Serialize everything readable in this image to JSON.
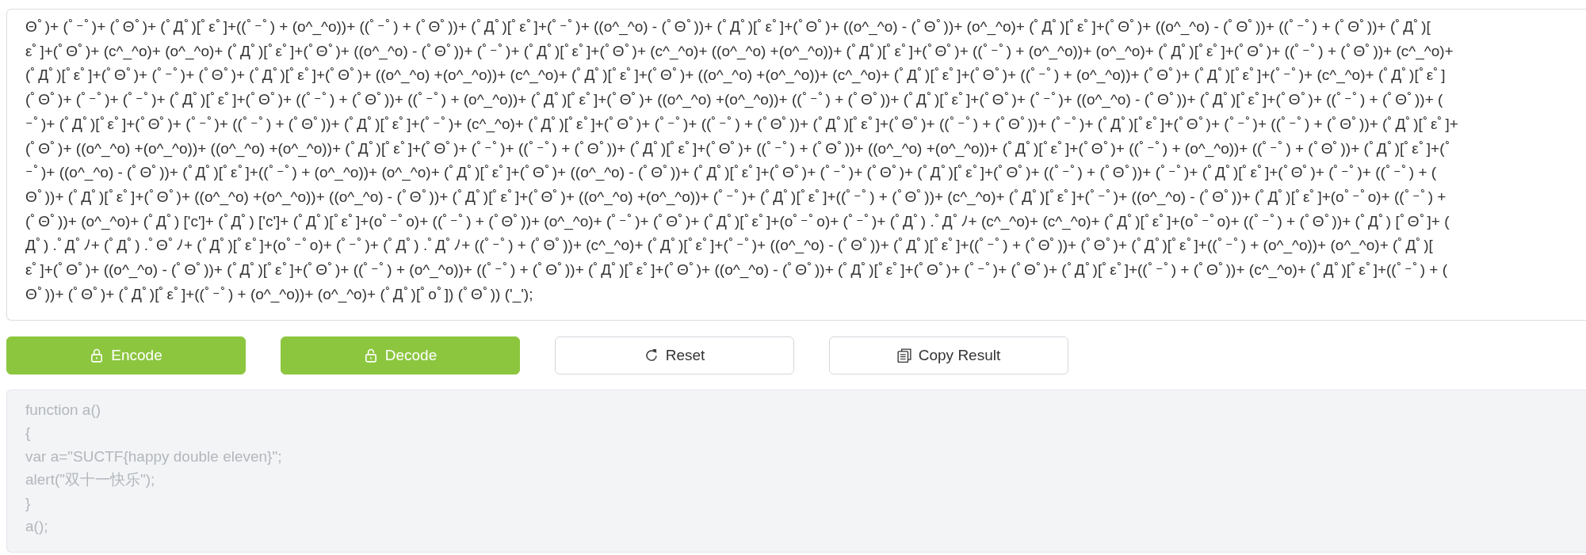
{
  "input": {
    "lines": [
      "Θﾟ)+ (ﾟｰﾟ)+ (ﾟΘﾟ)+ (ﾟДﾟ)[ﾟεﾟ]+((ﾟｰﾟ) + (o^_^o))+ ((ﾟｰﾟ) + (ﾟΘﾟ))+ (ﾟДﾟ)[ﾟεﾟ]+(ﾟｰﾟ)+ ((o^_^o) - (ﾟΘﾟ))+ (ﾟДﾟ)[ﾟεﾟ]+(ﾟΘﾟ)+ ((o^_^o) - (ﾟΘﾟ))+ (o^_^o)+ (ﾟДﾟ)[ﾟεﾟ]+(ﾟΘﾟ)+ ((o^_^o) - (ﾟΘﾟ))+ ((ﾟｰﾟ) + (ﾟΘﾟ))+ (ﾟДﾟ)[",
      "εﾟ]+(ﾟΘﾟ)+ (c^_^o)+ (o^_^o)+ (ﾟДﾟ)[ﾟεﾟ]+(ﾟΘﾟ)+ ((o^_^o) - (ﾟΘﾟ))+ (ﾟｰﾟ)+ (ﾟДﾟ)[ﾟεﾟ]+(ﾟΘﾟ)+ (c^_^o)+ ((o^_^o) +(o^_^o))+ (ﾟДﾟ)[ﾟεﾟ]+(ﾟΘﾟ)+ ((ﾟｰﾟ) + (o^_^o))+ (o^_^o)+ (ﾟДﾟ)[ﾟεﾟ]+(ﾟΘﾟ)+ ((ﾟｰﾟ) + (ﾟΘﾟ))+ (c^_^o)+",
      "(ﾟДﾟ)[ﾟεﾟ]+(ﾟΘﾟ)+ (ﾟｰﾟ)+ (ﾟΘﾟ)+ (ﾟДﾟ)[ﾟεﾟ]+(ﾟΘﾟ)+ ((o^_^o) +(o^_^o))+ (c^_^o)+ (ﾟДﾟ)[ﾟεﾟ]+(ﾟΘﾟ)+ ((o^_^o) +(o^_^o))+ (c^_^o)+ (ﾟДﾟ)[ﾟεﾟ]+(ﾟΘﾟ)+ ((ﾟｰﾟ) + (o^_^o))+ (ﾟΘﾟ)+ (ﾟДﾟ)[ﾟεﾟ]+(ﾟｰﾟ)+ (c^_^o)+ (ﾟДﾟ)[ﾟεﾟ]",
      "(ﾟΘﾟ)+ (ﾟｰﾟ)+ (ﾟｰﾟ)+ (ﾟДﾟ)[ﾟεﾟ]+(ﾟΘﾟ)+ ((ﾟｰﾟ) + (ﾟΘﾟ))+ ((ﾟｰﾟ) + (o^_^o))+ (ﾟДﾟ)[ﾟεﾟ]+(ﾟΘﾟ)+ ((o^_^o) +(o^_^o))+ ((ﾟｰﾟ) + (ﾟΘﾟ))+ (ﾟДﾟ)[ﾟεﾟ]+(ﾟΘﾟ)+ (ﾟｰﾟ)+ ((o^_^o) - (ﾟΘﾟ))+ (ﾟДﾟ)[ﾟεﾟ]+(ﾟΘﾟ)+ ((ﾟｰﾟ) + (ﾟΘﾟ))+ (",
      "ｰﾟ)+ (ﾟДﾟ)[ﾟεﾟ]+(ﾟΘﾟ)+ (ﾟｰﾟ)+ ((ﾟｰﾟ) + (ﾟΘﾟ))+ (ﾟДﾟ)[ﾟεﾟ]+(ﾟｰﾟ)+ (c^_^o)+ (ﾟДﾟ)[ﾟεﾟ]+(ﾟΘﾟ)+ (ﾟｰﾟ)+ ((ﾟｰﾟ) + (ﾟΘﾟ))+ (ﾟДﾟ)[ﾟεﾟ]+(ﾟΘﾟ)+ ((ﾟｰﾟ) + (ﾟΘﾟ))+ (ﾟｰﾟ)+ (ﾟДﾟ)[ﾟεﾟ]+(ﾟΘﾟ)+ (ﾟｰﾟ)+ ((ﾟｰﾟ) + (ﾟΘﾟ))+ (ﾟДﾟ)[ﾟεﾟ]+",
      "(ﾟΘﾟ)+ ((o^_^o) +(o^_^o))+ ((o^_^o) +(o^_^o))+ (ﾟДﾟ)[ﾟεﾟ]+(ﾟΘﾟ)+ (ﾟｰﾟ)+ ((ﾟｰﾟ) + (ﾟΘﾟ))+ (ﾟДﾟ)[ﾟεﾟ]+(ﾟΘﾟ)+ ((ﾟｰﾟ) + (ﾟΘﾟ))+ ((o^_^o) +(o^_^o))+ (ﾟДﾟ)[ﾟεﾟ]+(ﾟΘﾟ)+ ((ﾟｰﾟ) + (o^_^o))+ ((ﾟｰﾟ) + (ﾟΘﾟ))+ (ﾟДﾟ)[ﾟεﾟ]+(ﾟ",
      "ｰﾟ)+ ((o^_^o) - (ﾟΘﾟ))+ (ﾟДﾟ)[ﾟεﾟ]+((ﾟｰﾟ) + (o^_^o))+ (o^_^o)+ (ﾟДﾟ)[ﾟεﾟ]+(ﾟΘﾟ)+ ((o^_^o) - (ﾟΘﾟ))+ (ﾟДﾟ)[ﾟεﾟ]+(ﾟΘﾟ)+ (ﾟｰﾟ)+ (ﾟΘﾟ)+ (ﾟДﾟ)[ﾟεﾟ]+(ﾟΘﾟ)+ ((ﾟｰﾟ) + (ﾟΘﾟ))+ (ﾟｰﾟ)+ (ﾟДﾟ)[ﾟεﾟ]+(ﾟΘﾟ)+ (ﾟｰﾟ)+ ((ﾟｰﾟ) + (",
      "Θﾟ))+ (ﾟДﾟ)[ﾟεﾟ]+(ﾟΘﾟ)+ ((o^_^o) +(o^_^o))+ ((o^_^o) - (ﾟΘﾟ))+ (ﾟДﾟ)[ﾟεﾟ]+(ﾟΘﾟ)+ ((o^_^o) +(o^_^o))+ (ﾟｰﾟ)+ (ﾟДﾟ)[ﾟεﾟ]+((ﾟｰﾟ) + (ﾟΘﾟ))+ (c^_^o)+ (ﾟДﾟ)[ﾟεﾟ]+(ﾟｰﾟ)+ ((o^_^o) - (ﾟΘﾟ))+ (ﾟДﾟ)[ﾟεﾟ]+(oﾟｰﾟo)+ ((ﾟｰﾟ) +",
      "(ﾟΘﾟ))+ (o^_^o)+ (ﾟДﾟ) ['c']+ (ﾟДﾟ) ['c']+ (ﾟДﾟ)[ﾟεﾟ]+(oﾟｰﾟo)+ ((ﾟｰﾟ) + (ﾟΘﾟ))+ (o^_^o)+ (ﾟｰﾟ)+ (ﾟΘﾟ)+ (ﾟДﾟ)[ﾟεﾟ]+(oﾟｰﾟo)+ (ﾟｰﾟ)+ (ﾟДﾟ) .ﾟДﾟﾉ+ (c^_^o)+ (c^_^o)+ (ﾟДﾟ)[ﾟεﾟ]+(oﾟｰﾟo)+ ((ﾟｰﾟ) + (ﾟΘﾟ))+ (ﾟДﾟ) [ﾟΘﾟ]+ (",
      "Дﾟ) .ﾟДﾟﾉ+ (ﾟДﾟ) .ﾟΘﾟﾉ+ (ﾟДﾟ)[ﾟεﾟ]+(oﾟｰﾟo)+ (ﾟｰﾟ)+ (ﾟДﾟ) .ﾟДﾟﾉ+ ((ﾟｰﾟ) + (ﾟΘﾟ))+ (c^_^o)+ (ﾟДﾟ)[ﾟεﾟ]+(ﾟｰﾟ)+ ((o^_^o) - (ﾟΘﾟ))+ (ﾟДﾟ)[ﾟεﾟ]+((ﾟｰﾟ) + (ﾟΘﾟ))+ (ﾟΘﾟ)+ (ﾟДﾟ)[ﾟεﾟ]+((ﾟｰﾟ) + (o^_^o))+ (o^_^o)+ (ﾟДﾟ)[",
      "εﾟ]+(ﾟΘﾟ)+ ((o^_^o) - (ﾟΘﾟ))+ (ﾟДﾟ)[ﾟεﾟ]+(ﾟΘﾟ)+ ((ﾟｰﾟ) + (o^_^o))+ ((ﾟｰﾟ) + (ﾟΘﾟ))+ (ﾟДﾟ)[ﾟεﾟ]+(ﾟΘﾟ)+ ((o^_^o) - (ﾟΘﾟ))+ (ﾟДﾟ)[ﾟεﾟ]+(ﾟΘﾟ)+ (ﾟｰﾟ)+ (ﾟΘﾟ)+ (ﾟДﾟ)[ﾟεﾟ]+((ﾟｰﾟ) + (ﾟΘﾟ))+ (c^_^o)+ (ﾟДﾟ)[ﾟεﾟ]+((ﾟｰﾟ) + (",
      "Θﾟ))+ (ﾟΘﾟ)+ (ﾟДﾟ)[ﾟεﾟ]+((ﾟｰﾟ) + (o^_^o))+ (o^_^o)+ (ﾟДﾟ)[ﾟoﾟ]) (ﾟΘﾟ)) ('_');"
    ]
  },
  "buttons": [
    {
      "label": "Encode",
      "kind": "filled"
    },
    {
      "label": "Decode",
      "kind": "filled"
    },
    {
      "label": "Reset",
      "kind": "outline"
    },
    {
      "label": "Copy Result",
      "kind": "outline"
    }
  ],
  "output": {
    "disabled": true,
    "lines": [
      "function a()",
      "{",
      "var a=\"SUCTF{happy double eleven}\";",
      "alert(\"双十一快乐\");",
      "}",
      "a();"
    ]
  }
}
